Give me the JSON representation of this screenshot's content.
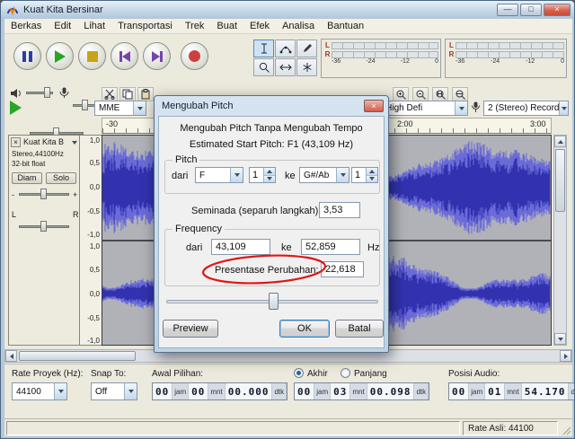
{
  "window": {
    "title": "Kuat Kita Bersinar",
    "controls": {
      "minimize": "—",
      "maximize": "□",
      "close": "×"
    }
  },
  "menu": {
    "items": [
      "Berkas",
      "Edit",
      "Lihat",
      "Transportasi",
      "Trek",
      "Buat",
      "Efek",
      "Analisa",
      "Bantuan"
    ]
  },
  "meters": {
    "left": "L",
    "right": "R",
    "scale": [
      "-36",
      "-24",
      "-12",
      "0"
    ]
  },
  "device": {
    "host": "MME",
    "output": "Speak High Defi",
    "input": "2 (Stereo) Record"
  },
  "timeline": {
    "labels": [
      "-30",
      "2:00",
      "3:00"
    ]
  },
  "track": {
    "close": "×",
    "name": "Kuat Kita B",
    "format": "Stereo,44100Hz",
    "depth": "32-bit float",
    "mute": "Diam",
    "solo": "Solo",
    "gain_minus": "-",
    "gain_plus": "+",
    "pan_left": "L",
    "pan_right": "R",
    "scale": [
      "1,0",
      "0,5",
      "0,0",
      "-0,5",
      "-1,0"
    ]
  },
  "dialog": {
    "title": "Mengubah Pitch",
    "close": "×",
    "line1": "Mengubah Pitch Tanpa Mengubah Tempo",
    "line2": "Estimated Start Pitch: F1 (43,109 Hz)",
    "pitch": {
      "label": "Pitch",
      "from_label": "dari",
      "from_note": "F",
      "from_octave": "1",
      "to_label": "ke",
      "to_note": "G#/Ab",
      "to_octave": "1"
    },
    "semitones_label": "Seminada (separuh langkah):",
    "semitones": "3,53",
    "freq": {
      "label": "Frequency",
      "from_label": "dari",
      "from": "43,109",
      "to_label": "ke",
      "to": "52,859",
      "unit": "Hz"
    },
    "percent_label": "Presentase Perubahan:",
    "percent": "22,618",
    "buttons": {
      "preview": "Preview",
      "ok": "OK",
      "cancel": "Batal"
    }
  },
  "selection": {
    "rate_label": "Rate Proyek (Hz):",
    "rate": "44100",
    "snap_label": "Snap To:",
    "snap": "Off",
    "start_label": "Awal Pilihan:",
    "end_radio": "Akhir",
    "length_radio": "Panjang",
    "audio_label": "Posisi Audio:",
    "unit_h": "jam",
    "unit_m": "mnt",
    "unit_s": "dtk",
    "start": {
      "h": "00",
      "m": "00",
      "s": "00.000"
    },
    "end": {
      "h": "00",
      "m": "03",
      "s": "00.098"
    },
    "audio": {
      "h": "00",
      "m": "01",
      "s": "54.170"
    }
  },
  "status": {
    "rate": "Rate Asli: 44100"
  }
}
